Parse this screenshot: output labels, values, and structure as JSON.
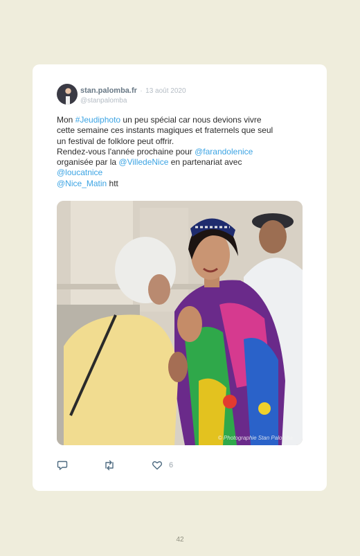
{
  "tweet": {
    "author_name": "stan.palomba.fr",
    "separator": "·",
    "date": "13 août 2020",
    "handle": "@stanpalomba",
    "lines": {
      "l1_a": "Mon ",
      "l1_tag": "#Jeudiphoto",
      "l1_b": " un peu spécial car nous devions vivre",
      "l2": "cette semaine ces instants magiques et fraternels que seul",
      "l3": "un festival de folklore peut offrir.",
      "l4_a": "Rendez-vous l'année prochaine pour ",
      "l4_mention": "@farandolenice",
      "l5_a": "organisée par la ",
      "l5_mention": "@VilledeNice",
      "l5_b": " en partenariat avec",
      "l6_mention": "@loucatnice",
      "l7_mention": "@Nice_Matin",
      "l7_b": " htt"
    },
    "photo_watermark": "© Photographie Stan Palomba",
    "like_count": "6",
    "icons": {
      "reply": "reply-icon",
      "retweet": "retweet-icon",
      "like": "heart-icon"
    },
    "colors": {
      "link": "#3aa3e3",
      "name": "#687885",
      "muted": "#b4bcc4",
      "page_bg": "#efeddc",
      "card_bg": "#ffffff"
    }
  },
  "page": {
    "number": "42"
  }
}
